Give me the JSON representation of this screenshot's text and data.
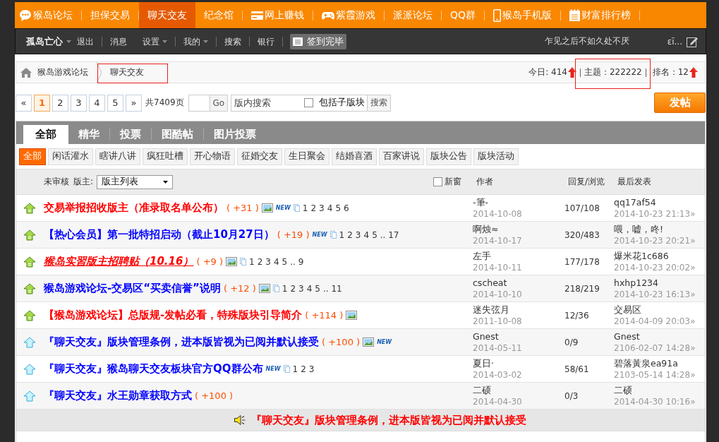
{
  "top_nav": {
    "items": [
      {
        "label": "猴岛论坛",
        "selected": false
      },
      {
        "label": "担保交易",
        "selected": false
      },
      {
        "label": "聊天交友",
        "selected": true
      },
      {
        "label": "纪念馆",
        "selected": false
      },
      {
        "label": "网上赚钱",
        "selected": false
      },
      {
        "label": "紫霞游戏",
        "selected": false
      },
      {
        "label": "派派论坛",
        "selected": false
      },
      {
        "label": "QQ群",
        "selected": false
      },
      {
        "label": "猴岛手机版",
        "selected": false
      },
      {
        "label": "财富排行榜",
        "selected": false
      }
    ]
  },
  "user_bar": {
    "username": "孤岛亡心",
    "links": [
      {
        "label": "退出",
        "dropdown": false,
        "divider": true
      },
      {
        "label": "消息",
        "dropdown": false,
        "divider": false
      },
      {
        "label": "设置",
        "dropdown": true,
        "divider": true
      },
      {
        "label": "我的",
        "dropdown": true,
        "divider": true
      },
      {
        "label": "搜索",
        "dropdown": false,
        "divider": true
      },
      {
        "label": "银行",
        "dropdown": false,
        "divider": true
      }
    ],
    "checkin_button": "签到完毕",
    "motto": "乍见之后不如久处不厌",
    "nickname": "εï..."
  },
  "breadcrumb": {
    "items": [
      {
        "label": "猴岛游戏论坛",
        "marked": false
      },
      {
        "label": "聊天交友",
        "marked": true
      }
    ],
    "stats": [
      {
        "text": "今日: 414",
        "rising": true,
        "marked": false
      },
      {
        "text": "主题：222222",
        "rising": false,
        "marked": true
      },
      {
        "text": "排名：12",
        "rising": true,
        "marked": false
      }
    ]
  },
  "pager": {
    "prev": "«",
    "pages": [
      {
        "label": "1",
        "selected": true
      },
      {
        "label": "2",
        "selected": false
      },
      {
        "label": "3",
        "selected": false
      },
      {
        "label": "4",
        "selected": false
      },
      {
        "label": "5",
        "selected": false
      }
    ],
    "next": "»",
    "total": "共7409页",
    "goto_button": "Go",
    "search": {
      "placeholder": "版内搜索"
    },
    "include_subboards": {
      "label": "包括子版块",
      "checked": false
    },
    "search_button": "搜索",
    "post_button": "发帖"
  },
  "tabs": [
    {
      "label": "全部",
      "selected": true
    },
    {
      "label": "精华",
      "selected": false
    },
    {
      "label": "投票",
      "selected": false
    },
    {
      "label": "图酷帖",
      "selected": false
    },
    {
      "label": "图片投票",
      "selected": false
    }
  ],
  "categories": [
    {
      "label": "全部",
      "selected": true
    },
    {
      "label": "闲话灌水",
      "selected": false
    },
    {
      "label": "瞎讲八讲",
      "selected": false
    },
    {
      "label": "疯狂吐槽",
      "selected": false
    },
    {
      "label": "开心物语",
      "selected": false
    },
    {
      "label": "征婚交友",
      "selected": false
    },
    {
      "label": "生日聚会",
      "selected": false
    },
    {
      "label": "结婚喜酒",
      "selected": false
    },
    {
      "label": "百家讲说",
      "selected": false
    },
    {
      "label": "版块公告",
      "selected": false
    },
    {
      "label": "版块活动",
      "selected": false
    }
  ],
  "list_header": {
    "unreviewed": "未审核",
    "moderators_label": "版主:",
    "moderators_select": "版主列表",
    "new_window": {
      "label": "新窗",
      "checked": false
    },
    "author": "作者",
    "replies_views": "回复/浏览",
    "last_post": "最后发表"
  },
  "threads": [
    {
      "kind": "global",
      "title": "交易举报招收版主（准录取名单公布）",
      "color": "#ff0000",
      "italic": false,
      "underline": false,
      "heat": "( +31 )",
      "has_image": true,
      "new_badge": "NEW",
      "pages": [
        "1",
        "2",
        "3",
        "4",
        "5",
        "6"
      ],
      "author": "-筆-",
      "date": "2014-10-08",
      "replies_views": "107/108",
      "last_poster": "qq17af54",
      "last_time": "2014-10-23 21:13»"
    },
    {
      "kind": "global",
      "title": "【热心会员】第一批特招启动（截止10月27日）",
      "color": "#0000ff",
      "italic": false,
      "underline": false,
      "heat": "( +19 )",
      "has_image": false,
      "new_badge": "NEW",
      "pages": [
        "1",
        "2",
        "3",
        "4",
        "5",
        ".. 17"
      ],
      "author": "啊烛≈",
      "date": "2014-10-17",
      "replies_views": "320/483",
      "last_poster": "喂，嘘，咚!",
      "last_time": "2014-10-23 20:21»"
    },
    {
      "kind": "global",
      "title": "猴岛实習版主招聘贴（10.16）",
      "color": "#ff0000",
      "italic": true,
      "underline": true,
      "heat": "( +9 )",
      "has_image": true,
      "pages": [
        "1",
        "2",
        "3",
        "4",
        "5",
        ".. 9"
      ],
      "author": "左手",
      "date": "2014-10-11",
      "replies_views": "177/178",
      "last_poster": "爆米花1c686",
      "last_time": "2014-10-23 20:02»"
    },
    {
      "kind": "global",
      "title": "猴岛游戏论坛-交易区“买卖信誉”说明",
      "color": "#0000ff",
      "italic": false,
      "underline": false,
      "heat": "( +12 )",
      "has_image": true,
      "pages": [
        "1",
        "2",
        "3",
        "4",
        "5",
        ".. 11"
      ],
      "author": "cscheat",
      "date": "2014-10-10",
      "replies_views": "218/219",
      "last_poster": "hxhp1234",
      "last_time": "2014-10-23 16:13»"
    },
    {
      "kind": "global",
      "title": "【猴岛游戏论坛】总版规-发帖必看，特殊版块引导简介",
      "color": "#ff0000",
      "italic": false,
      "underline": false,
      "heat": "( +114 )",
      "has_image": true,
      "author": "迷失弦月",
      "date": "2011-10-08",
      "replies_views": "12/36",
      "last_poster": "交易区",
      "last_time": "2014-04-09 20:03»"
    },
    {
      "kind": "board",
      "title": "『聊天交友』版块管理条例，进本版皆视为已阅并默认接受",
      "color": "#0000ff",
      "italic": false,
      "underline": false,
      "heat": "( +100 )",
      "has_image": true,
      "new_badge": "NEW",
      "author": "Gnest",
      "date": "2014-05-11",
      "replies_views": "0/9",
      "last_poster": "Gnest",
      "last_time": "2106-02-07 14:28»"
    },
    {
      "kind": "board",
      "title": "『聊天交友』猴岛聊天交友板块官方QQ群公布",
      "color": "#0000ff",
      "italic": false,
      "underline": false,
      "has_image": false,
      "new_badge": "NEW",
      "pages": [
        "1",
        "2",
        "3"
      ],
      "author": "夏日·",
      "date": "2014-03-02",
      "replies_views": "58/61",
      "last_poster": "碧落黃泉ea91a",
      "last_time": "2103-05-14 14:28»"
    },
    {
      "kind": "board",
      "title": "『聊天交友』水王勋章获取方式",
      "color": "#0000ff",
      "italic": false,
      "underline": false,
      "heat": "( +100 )",
      "has_image": false,
      "author": "二硕",
      "date": "2014-04-30",
      "replies_views": "0/3",
      "last_poster": "二硕",
      "last_time": "2014-04-30 10:16»"
    }
  ],
  "announcement": {
    "text": "『聊天交友』版块管理条例，进本版皆视为已阅并默认接受"
  }
}
